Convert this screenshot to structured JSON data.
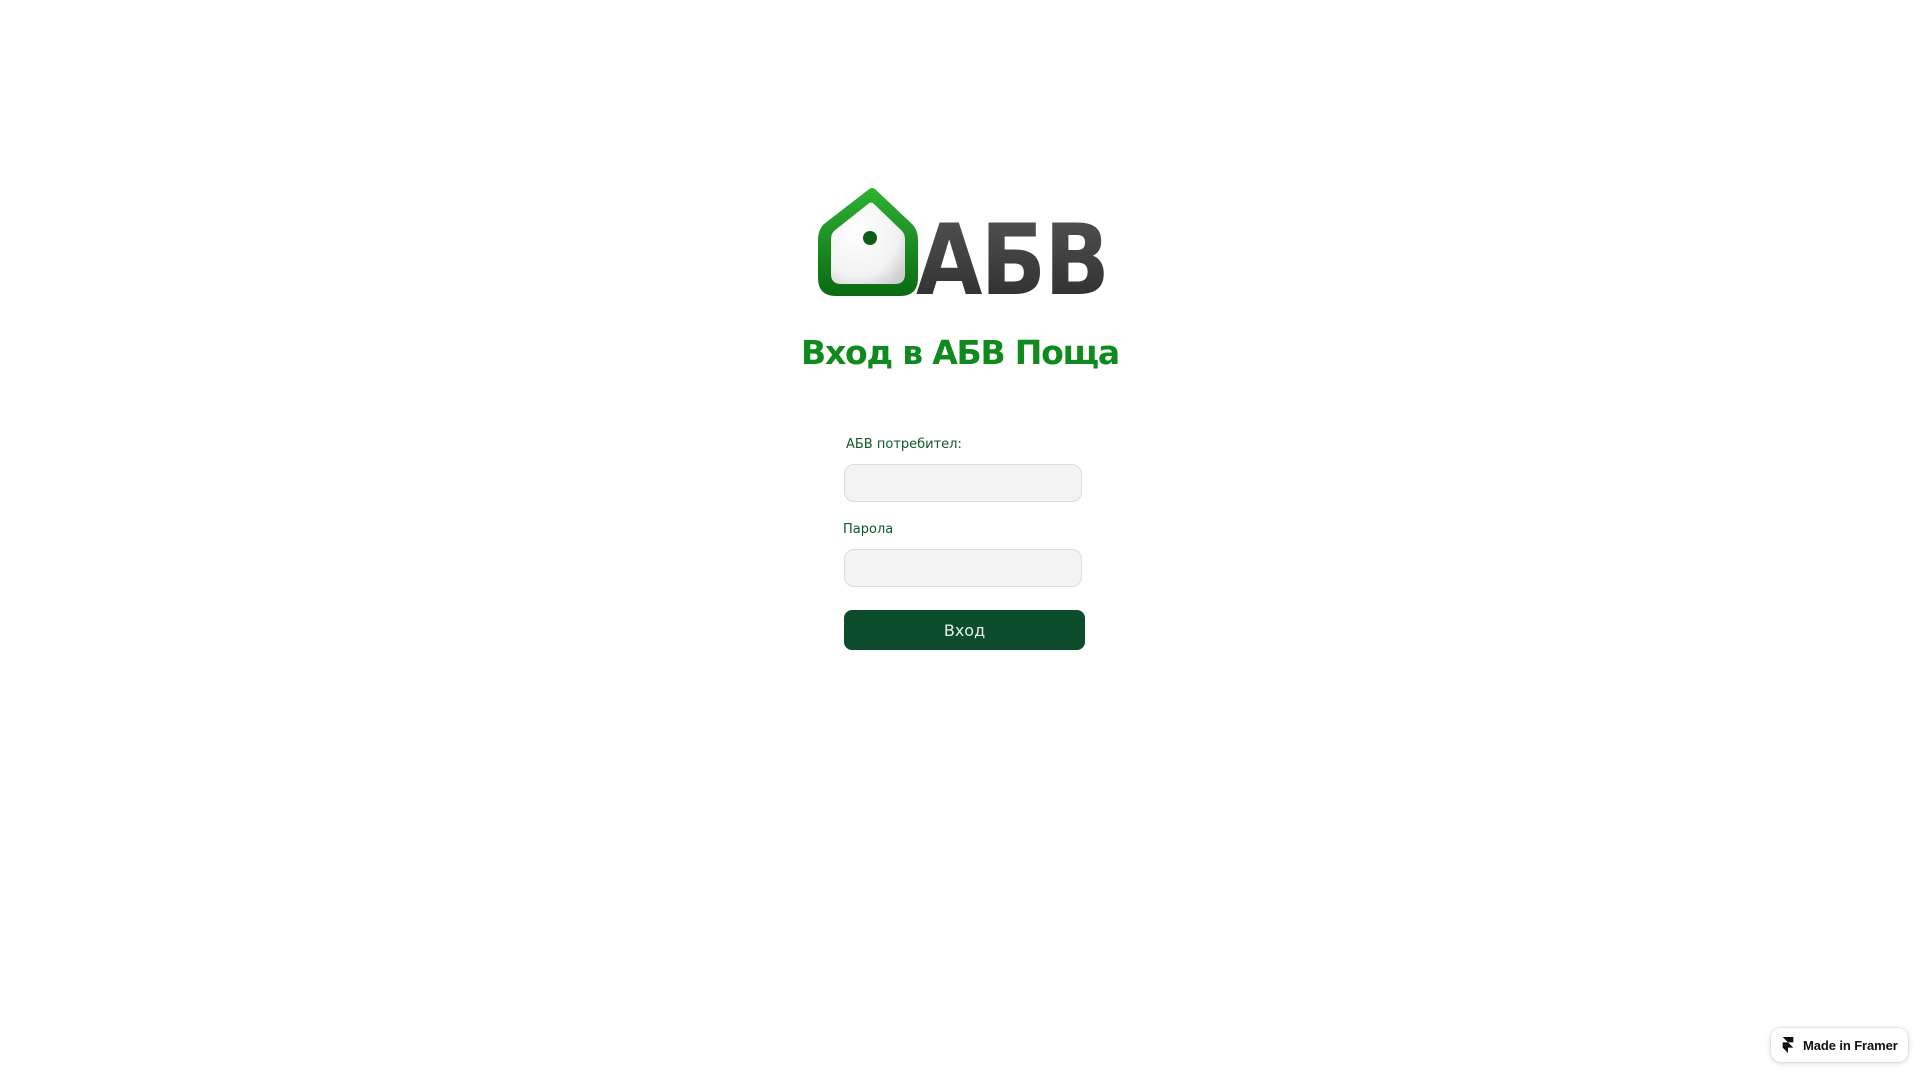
{
  "logo": {
    "text": "АБВ",
    "icon": "house-icon",
    "colors": {
      "house_green": "#12901e",
      "letters_gray": "#3d3d3d"
    }
  },
  "login": {
    "title": "Вход в АБВ Поща",
    "username_label": "АБВ потребител:",
    "username_value": "",
    "password_label": "Парола",
    "password_value": "",
    "submit_label": "Вход"
  },
  "badge": {
    "label": "Made in Framer",
    "icon": "framer-icon"
  },
  "colors": {
    "title": "#0f8a1e",
    "label": "#0d5a24",
    "button": "#0d4d2b",
    "input_bg": "#f3f3f3"
  }
}
